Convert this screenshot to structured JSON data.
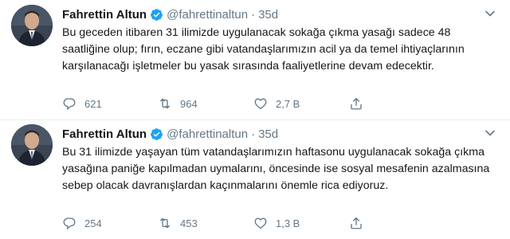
{
  "colors": {
    "text": "#14171a",
    "muted": "#657786",
    "verified": "#1da1f2",
    "divider": "#e6ecf0"
  },
  "tweets": [
    {
      "display_name": "Fahrettin Altun",
      "handle": "@fahrettinaltun",
      "separator": "·",
      "time": "35d",
      "text": "Bu geceden itibaren 31 ilimizde uygulanacak sokağa çıkma yasağı sadece 48 saatliğine olup; fırın, eczane gibi vatandaşlarımızın acil ya da temel ihtiyaçlarının karşılanacağı işletmeler bu yasak sırasında faaliyetlerine devam edecektir.",
      "replies": "621",
      "retweets": "964",
      "likes": "2,7 B",
      "icons": [
        "avatar",
        "verified-badge-icon",
        "caret-down-icon",
        "reply-icon",
        "retweet-icon",
        "like-icon",
        "share-icon"
      ]
    },
    {
      "display_name": "Fahrettin Altun",
      "handle": "@fahrettinaltun",
      "separator": "·",
      "time": "35d",
      "text": "Bu 31 ilimizde yaşayan tüm vatandaşlarımızın haftasonu uygulanacak sokağa çıkma yasağına paniğe kapılmadan uymalarını, öncesinde ise sosyal mesafenin azalmasına sebep olacak davranışlardan kaçınmalarını önemle rica ediyoruz.",
      "replies": "254",
      "retweets": "453",
      "likes": "1,3 B",
      "icons": [
        "avatar",
        "verified-badge-icon",
        "caret-down-icon",
        "reply-icon",
        "retweet-icon",
        "like-icon",
        "share-icon"
      ]
    }
  ]
}
